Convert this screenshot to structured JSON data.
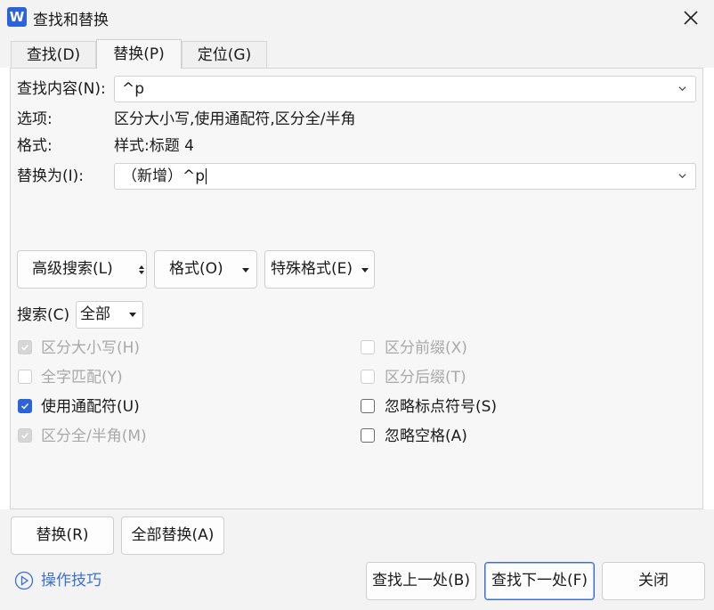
{
  "window": {
    "title": "查找和替换",
    "app_icon_letter": "W"
  },
  "tabs": [
    {
      "label": "查找(D)",
      "active": false
    },
    {
      "label": "替换(P)",
      "active": true
    },
    {
      "label": "定位(G)",
      "active": false
    }
  ],
  "find": {
    "label": "查找内容(N):",
    "value": "^p"
  },
  "options": {
    "label": "选项:",
    "value": "区分大小写,使用通配符,区分全/半角"
  },
  "format": {
    "label": "格式:",
    "value": "样式:标题 4"
  },
  "replace": {
    "label": "替换为(I):",
    "value": "（新增）^p"
  },
  "buttons_row": {
    "advanced": "高级搜索(L)",
    "format": "格式(O)",
    "special": "特殊格式(E)"
  },
  "search": {
    "label": "搜索(C)",
    "value": "全部"
  },
  "checkboxes_left": [
    {
      "label": "区分大小写(H)",
      "checked": true,
      "disabled": true
    },
    {
      "label": "全字匹配(Y)",
      "checked": false,
      "disabled": true
    },
    {
      "label": "使用通配符(U)",
      "checked": true,
      "disabled": false
    },
    {
      "label": "区分全/半角(M)",
      "checked": true,
      "disabled": true
    }
  ],
  "checkboxes_right": [
    {
      "label": "区分前缀(X)",
      "checked": false,
      "disabled": true
    },
    {
      "label": "区分后缀(T)",
      "checked": false,
      "disabled": true
    },
    {
      "label": "忽略标点符号(S)",
      "checked": false,
      "disabled": false
    },
    {
      "label": "忽略空格(A)",
      "checked": false,
      "disabled": false
    }
  ],
  "actions": {
    "replace": "替换(R)",
    "replace_all": "全部替换(A)",
    "tips": "操作技巧",
    "find_prev": "查找上一处(B)",
    "find_next": "查找下一处(F)",
    "close": "关闭"
  },
  "colors": {
    "accent": "#2b63d9",
    "link": "#3b6fd6"
  }
}
